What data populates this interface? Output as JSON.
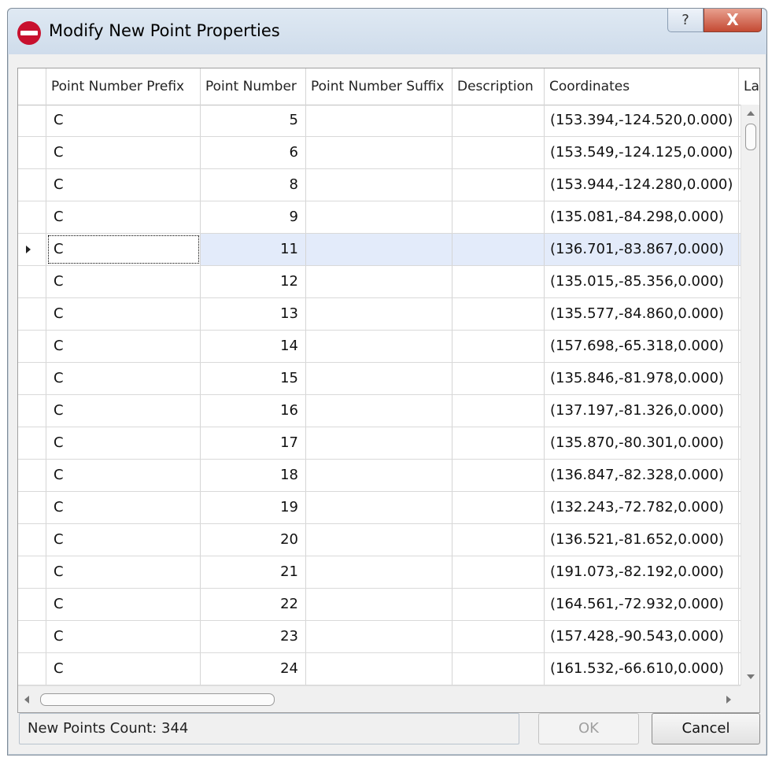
{
  "window": {
    "title": "Modify New Point Properties"
  },
  "titlebar_buttons": {
    "help": "?",
    "close": "X"
  },
  "grid": {
    "columns": [
      "Point Number Prefix",
      "Point Number",
      "Point Number Suffix",
      "Description",
      "Coordinates",
      "Lay"
    ],
    "rows": [
      {
        "prefix": "C",
        "number": "5",
        "suffix": "",
        "description": "",
        "coordinates": "(153.394,-124.520,0.000)"
      },
      {
        "prefix": "C",
        "number": "6",
        "suffix": "",
        "description": "",
        "coordinates": "(153.549,-124.125,0.000)"
      },
      {
        "prefix": "C",
        "number": "8",
        "suffix": "",
        "description": "",
        "coordinates": "(153.944,-124.280,0.000)"
      },
      {
        "prefix": "C",
        "number": "9",
        "suffix": "",
        "description": "",
        "coordinates": "(135.081,-84.298,0.000)"
      },
      {
        "prefix": "C",
        "number": "11",
        "suffix": "",
        "description": "",
        "coordinates": "(136.701,-83.867,0.000)"
      },
      {
        "prefix": "C",
        "number": "12",
        "suffix": "",
        "description": "",
        "coordinates": "(135.015,-85.356,0.000)"
      },
      {
        "prefix": "C",
        "number": "13",
        "suffix": "",
        "description": "",
        "coordinates": "(135.577,-84.860,0.000)"
      },
      {
        "prefix": "C",
        "number": "14",
        "suffix": "",
        "description": "",
        "coordinates": "(157.698,-65.318,0.000)"
      },
      {
        "prefix": "C",
        "number": "15",
        "suffix": "",
        "description": "",
        "coordinates": "(135.846,-81.978,0.000)"
      },
      {
        "prefix": "C",
        "number": "16",
        "suffix": "",
        "description": "",
        "coordinates": "(137.197,-81.326,0.000)"
      },
      {
        "prefix": "C",
        "number": "17",
        "suffix": "",
        "description": "",
        "coordinates": "(135.870,-80.301,0.000)"
      },
      {
        "prefix": "C",
        "number": "18",
        "suffix": "",
        "description": "",
        "coordinates": "(136.847,-82.328,0.000)"
      },
      {
        "prefix": "C",
        "number": "19",
        "suffix": "",
        "description": "",
        "coordinates": "(132.243,-72.782,0.000)"
      },
      {
        "prefix": "C",
        "number": "20",
        "suffix": "",
        "description": "",
        "coordinates": "(136.521,-81.652,0.000)"
      },
      {
        "prefix": "C",
        "number": "21",
        "suffix": "",
        "description": "",
        "coordinates": "(191.073,-82.192,0.000)"
      },
      {
        "prefix": "C",
        "number": "22",
        "suffix": "",
        "description": "",
        "coordinates": "(164.561,-72.932,0.000)"
      },
      {
        "prefix": "C",
        "number": "23",
        "suffix": "",
        "description": "",
        "coordinates": "(157.428,-90.543,0.000)"
      },
      {
        "prefix": "C",
        "number": "24",
        "suffix": "",
        "description": "",
        "coordinates": "(161.532,-66.610,0.000)"
      }
    ],
    "selected_row_index": 4,
    "layer_marker": "ı"
  },
  "status": {
    "label": "New Points Count:",
    "count": "344"
  },
  "buttons": {
    "ok": "OK",
    "cancel": "Cancel"
  },
  "colors": {
    "selection": "#e3ebfa",
    "close_button": "#c44a33",
    "app_icon": "#c8102e"
  },
  "icons": {
    "app": "app-logo-icon",
    "help": "help-icon",
    "close": "close-icon"
  }
}
